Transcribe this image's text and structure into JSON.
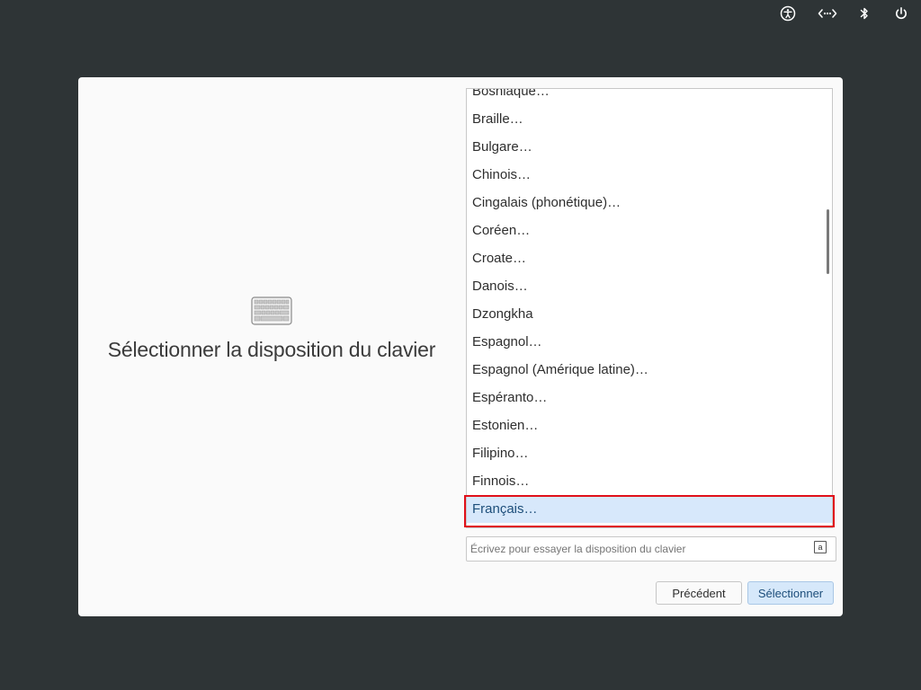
{
  "topbar": {
    "icons": [
      {
        "name": "accessibility-icon"
      },
      {
        "name": "network-icon"
      },
      {
        "name": "bluetooth-icon"
      },
      {
        "name": "power-icon"
      }
    ]
  },
  "dialog": {
    "title": "Sélectionner la disposition du clavier",
    "layouts": [
      "Bosniaque…",
      "Braille…",
      "Bulgare…",
      "Chinois…",
      "Cingalais (phonétique)…",
      "Coréen…",
      "Croate…",
      "Danois…",
      "Dzongkha",
      "Espagnol…",
      "Espagnol (Amérique latine)…",
      "Espéranto…",
      "Estonien…",
      "Filipino…",
      "Finnois…",
      "Français…"
    ],
    "selected_layout": "Français…",
    "try_input": {
      "placeholder": "Écrivez pour essayer la disposition du clavier",
      "value": ""
    },
    "input_icon_glyph": "a",
    "buttons": {
      "previous": "Précédent",
      "select": "Sélectionner"
    }
  },
  "colors": {
    "background": "#2e3436",
    "selection": "#d7e8fb",
    "annotation_box": "#e0101a"
  }
}
